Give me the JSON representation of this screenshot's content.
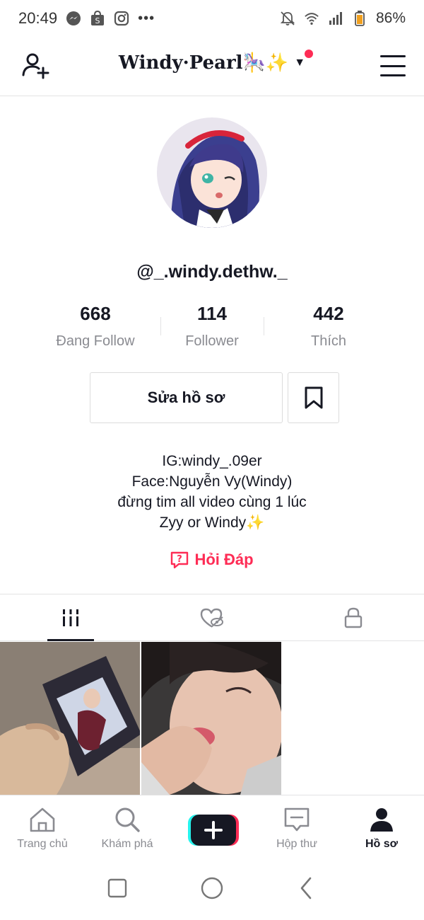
{
  "status_bar": {
    "time": "20:49",
    "battery_percent": "86%",
    "icons": [
      "messenger-icon",
      "shopee-icon",
      "instagram-icon",
      "more-dots-icon",
      "mute-icon",
      "wifi-icon",
      "signal-icon",
      "battery-icon"
    ]
  },
  "header": {
    "display_name": "Windy·Pearl🎠✨",
    "has_notification_dot": true
  },
  "profile": {
    "username": "@_.windy.dethw._",
    "stats": [
      {
        "value": "668",
        "label": "Đang Follow"
      },
      {
        "value": "114",
        "label": "Follower"
      },
      {
        "value": "442",
        "label": "Thích"
      }
    ],
    "edit_button_label": "Sửa hồ sơ",
    "bio_lines": [
      "IG:windy_.09er",
      "Face:Nguyễn Vy(Windy)",
      "đừng tim all video cùng 1 lúc",
      "Zyy or Windy✨"
    ],
    "qa_label": "Hỏi Đáp"
  },
  "tabs": [
    {
      "name": "videos",
      "active": true
    },
    {
      "name": "liked",
      "active": false
    },
    {
      "name": "private",
      "active": false
    }
  ],
  "bottom_nav": {
    "items": [
      {
        "label": "Trang chủ",
        "active": false
      },
      {
        "label": "Khám phá",
        "active": false
      },
      {
        "label": "",
        "active": false
      },
      {
        "label": "Hộp thư",
        "active": false
      },
      {
        "label": "Hồ sơ",
        "active": true
      }
    ]
  },
  "colors": {
    "accent": "#fe2c55",
    "text": "#161823",
    "muted": "#8a8b91",
    "border": "#e3e3e4"
  }
}
